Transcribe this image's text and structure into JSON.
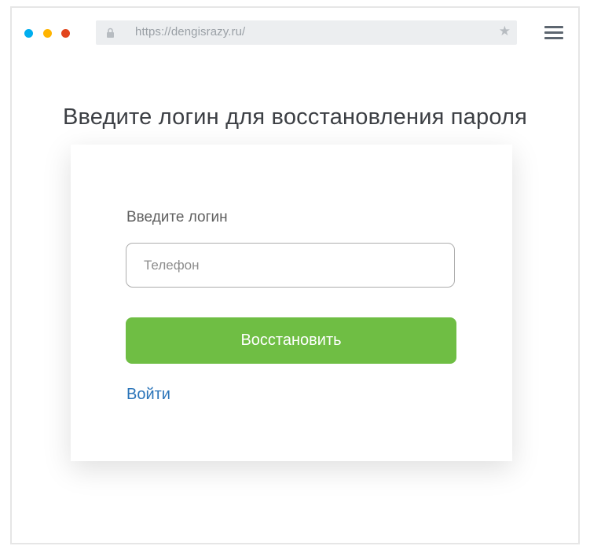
{
  "browser": {
    "url": "https://dengisrazy.ru/",
    "dots": [
      {
        "name": "blue",
        "color": "#00aeef"
      },
      {
        "name": "yellow",
        "color": "#ffb400"
      },
      {
        "name": "red",
        "color": "#e2451d"
      }
    ],
    "icons": {
      "lock": "lock-icon",
      "star": "star-icon",
      "menu": "hamburger-menu-icon"
    }
  },
  "page": {
    "title": "Введите логин для восстановления пароля"
  },
  "form": {
    "label": "Введите логин",
    "input_placeholder": "Телефон",
    "input_value": "",
    "submit_label": "Восстановить",
    "login_link": "Войти"
  },
  "colors": {
    "accent_green": "#6fbe44",
    "link_blue": "#2a74b9"
  }
}
